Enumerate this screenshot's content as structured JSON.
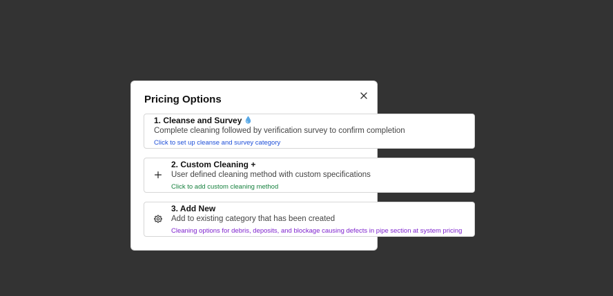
{
  "dialog": {
    "title": "Pricing Options",
    "close_icon": "close-icon"
  },
  "options": [
    {
      "title": "1. Cleanse and Survey",
      "icon": "water-drop-icon",
      "description": "Complete cleaning followed by verification survey to confirm completion",
      "link": "Click to set up cleanse and survey category",
      "link_color": "#1d4ed8"
    },
    {
      "title": "2. Custom Cleaning +",
      "icon": "plus-icon",
      "description": "User defined cleaning method with custom specifications",
      "link": "Click to add custom cleaning method",
      "link_color": "#15803d"
    },
    {
      "title": "3. Add New",
      "icon": "gear-icon",
      "description": "Add to existing category that has been created",
      "link": "Cleaning options for debris, deposits, and blockage causing defects in pipe section at system pricing",
      "link_color": "#7e22ce"
    }
  ],
  "colors": {
    "backdrop": "#333333",
    "dialog_bg": "#ffffff",
    "drop": "#5aa9e6"
  }
}
